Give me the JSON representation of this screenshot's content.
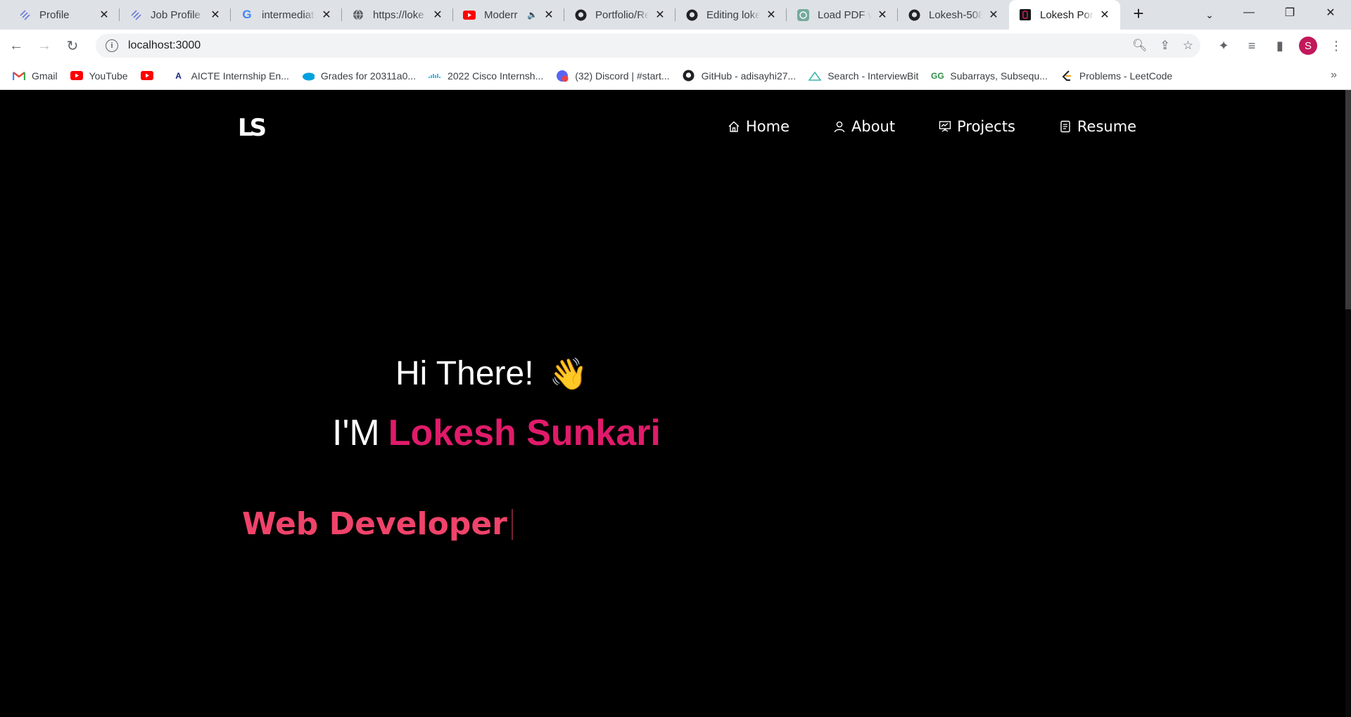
{
  "browser": {
    "tabs": [
      {
        "title": "Profile",
        "favicon": "stripes-icon"
      },
      {
        "title": "Job Profile",
        "favicon": "stripes-icon"
      },
      {
        "title": "intermediate",
        "favicon": "google-icon"
      },
      {
        "title": "https://loke",
        "favicon": "globe-icon"
      },
      {
        "title": "Moderr",
        "favicon": "youtube-icon",
        "audio": true
      },
      {
        "title": "Portfolio/Re",
        "favicon": "github-icon"
      },
      {
        "title": "Editing loke",
        "favicon": "github-icon"
      },
      {
        "title": "Load PDF w",
        "favicon": "chatgpt-icon"
      },
      {
        "title": "Lokesh-508",
        "favicon": "github-icon"
      },
      {
        "title": "Lokesh Port",
        "favicon": "portfolio-icon",
        "active": true
      }
    ],
    "url": "localhost:3000",
    "profile_initial": "S",
    "bookmarks": [
      {
        "label": "Gmail",
        "icon": "gmail-icon"
      },
      {
        "label": "YouTube",
        "icon": "youtube-icon"
      },
      {
        "label": "",
        "icon": "youtube-icon"
      },
      {
        "label": "AICTE Internship En...",
        "icon": "aicte-icon"
      },
      {
        "label": "Grades for 20311a0...",
        "icon": "salesforce-icon"
      },
      {
        "label": "2022 Cisco Internsh...",
        "icon": "cisco-icon"
      },
      {
        "label": "(32) Discord | #start...",
        "icon": "discord-icon"
      },
      {
        "label": "GitHub - adisayhi27...",
        "icon": "github-icon"
      },
      {
        "label": "Search - InterviewBit",
        "icon": "interviewbit-icon"
      },
      {
        "label": "Subarrays, Subsequ...",
        "icon": "gfg-icon"
      },
      {
        "label": "Problems - LeetCode",
        "icon": "leetcode-icon"
      }
    ]
  },
  "site": {
    "logo_text": "LS",
    "nav": [
      {
        "label": "Home",
        "icon": "home-icon"
      },
      {
        "label": "About",
        "icon": "user-icon"
      },
      {
        "label": "Projects",
        "icon": "projects-icon"
      },
      {
        "label": "Resume",
        "icon": "resume-icon"
      }
    ],
    "greeting": "Hi There!",
    "wave_emoji": "👋",
    "intro_prefix": "I'M",
    "name": "Lokesh Sunkari",
    "role": "Web Developer",
    "colors": {
      "accent": "#e01b6a",
      "role": "#f0436a",
      "background": "#000000"
    }
  }
}
